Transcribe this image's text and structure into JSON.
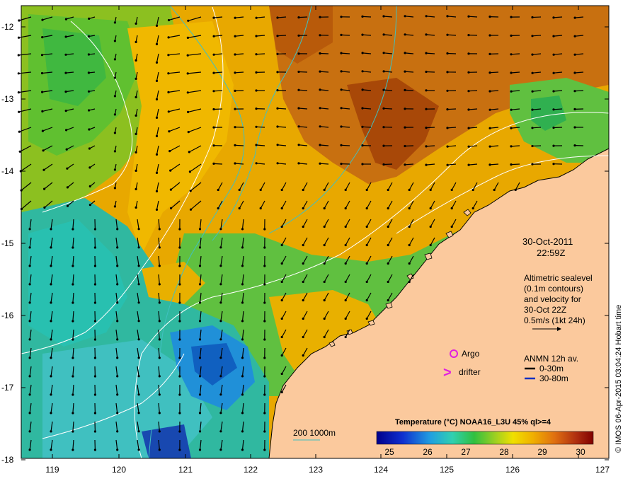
{
  "map": {
    "lon_ticks": [
      "119",
      "120",
      "121",
      "122",
      "123",
      "124",
      "125",
      "126",
      "127"
    ],
    "lat_ticks": [
      "-12",
      "-13",
      "-14",
      "-15",
      "-16",
      "-17",
      "-18"
    ]
  },
  "annotations": {
    "date": "30-Oct-2011",
    "time": "22:59Z",
    "altimetry": [
      "Altimetric sealevel",
      "(0.1m contours)",
      "and velocity for",
      "30-Oct 22Z",
      "0.5m/s (1kt 24h)"
    ],
    "argo_label": "Argo",
    "drifter_label": "drifter",
    "drifter_symbol": ">",
    "anmn_title": "ANMN 12h av.",
    "anmn_depth_shallow": "0-30m",
    "anmn_depth_deep": "30-80m",
    "bathymetry_label": "200  1000m"
  },
  "colorbar": {
    "title": "Temperature (°C) NOAA16_L3U 45% ql>=4",
    "ticks": [
      "25",
      "26",
      "27",
      "28",
      "29",
      "30"
    ]
  },
  "credit": "© IMOS 06-Apr-2015 03:04:24 Hobart time",
  "colors": {
    "land": "#fbc99d",
    "argo": "#e020e0",
    "drifter": "#e020e0",
    "isobath": "#40c0c0",
    "sealevel_contour": "#ffffff",
    "anmn_shallow": "#000000",
    "anmn_deep": "#1030c0"
  }
}
